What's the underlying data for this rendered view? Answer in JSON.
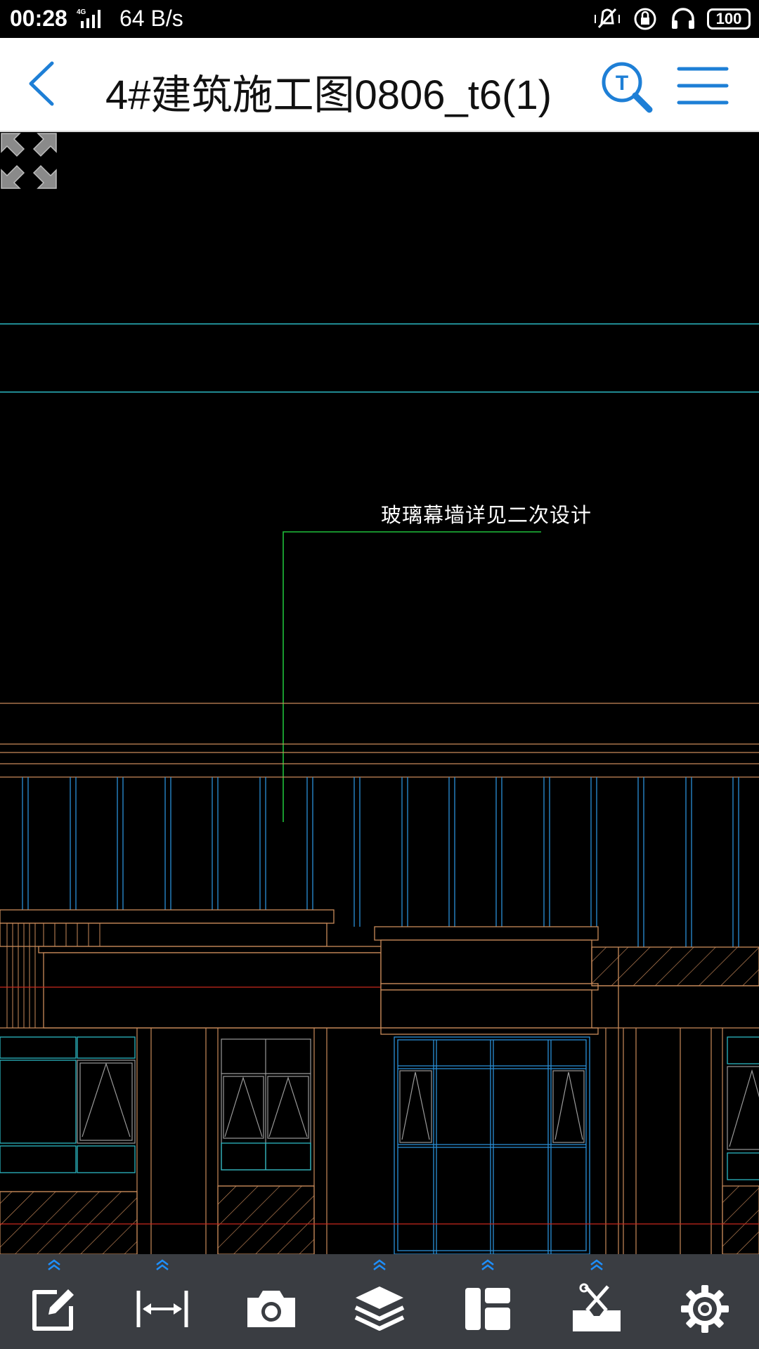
{
  "status_bar": {
    "time": "00:28",
    "network": "4G",
    "speed": "64 B/s",
    "battery": "100",
    "icons": [
      "vibrate-icon",
      "rotation-lock-icon",
      "headphones-icon",
      "battery-icon"
    ]
  },
  "header": {
    "title": "4#建筑施工图0806_t6(1)",
    "back_icon": "chevron-left-icon",
    "search_icon": "text-search-icon",
    "menu_icon": "hamburger-menu-icon",
    "accent_color": "#1e7fd6"
  },
  "drawing": {
    "annotation": "玻璃幕墙详见二次设计",
    "background": "#000000",
    "line_colors": {
      "cyan": "#2bb7c2",
      "green": "#1fbf3a",
      "orange": "#c98a5a",
      "blue": "#2a8fd8",
      "red": "#c8281e",
      "white": "#d0d0d0"
    },
    "fit_icon": "fit-screen-icon"
  },
  "toolbar": {
    "items": [
      {
        "name": "annotate-tool",
        "icon": "edit-icon",
        "has_submenu": true
      },
      {
        "name": "measure-tool",
        "icon": "measure-icon",
        "has_submenu": true
      },
      {
        "name": "screenshot-tool",
        "icon": "camera-icon",
        "has_submenu": false
      },
      {
        "name": "layers-tool",
        "icon": "layers-icon",
        "has_submenu": true
      },
      {
        "name": "layout-tool",
        "icon": "layout-icon",
        "has_submenu": true
      },
      {
        "name": "toolbox-tool",
        "icon": "toolbox-icon",
        "has_submenu": true
      },
      {
        "name": "settings-tool",
        "icon": "gear-icon",
        "has_submenu": false
      }
    ]
  }
}
